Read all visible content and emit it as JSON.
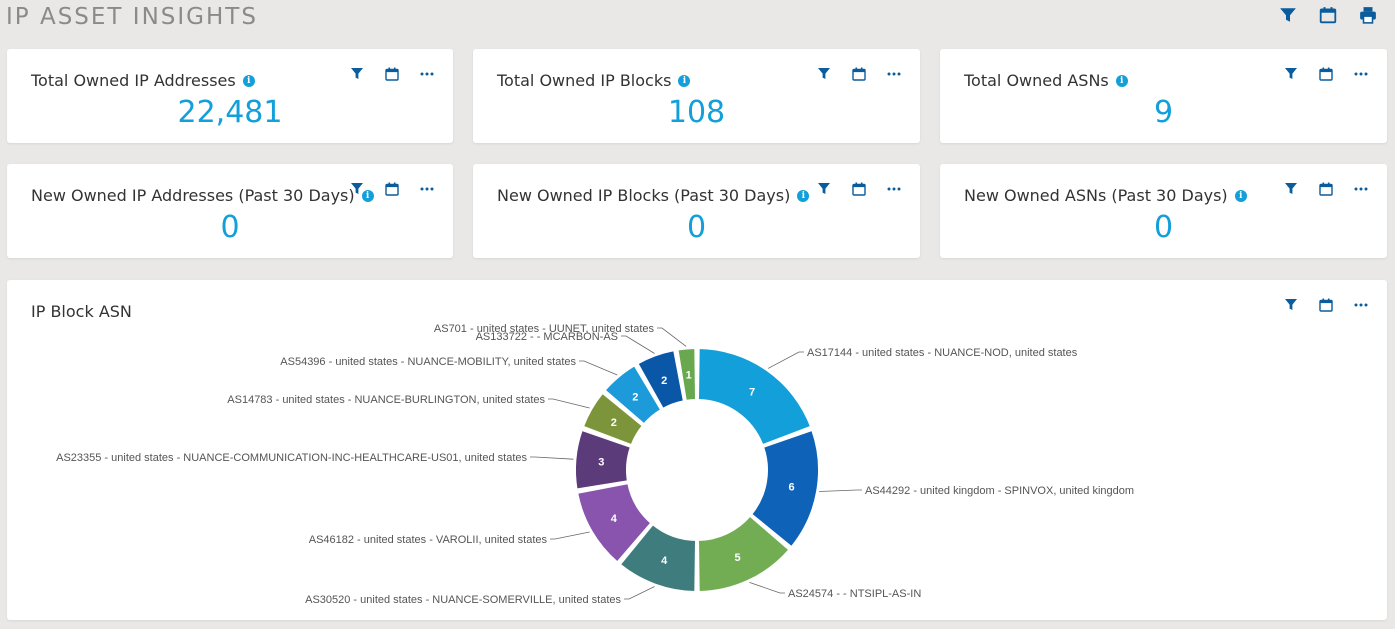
{
  "page": {
    "title": "IP ASSET INSIGHTS"
  },
  "colors": {
    "accent": "#139fd9",
    "icon": "#0a5c9c"
  },
  "cards": [
    {
      "title": "Total Owned IP Addresses",
      "value": "22,481"
    },
    {
      "title": "Total Owned IP Blocks",
      "value": "108"
    },
    {
      "title": "Total Owned ASNs",
      "value": "9"
    },
    {
      "title": "New Owned IP Addresses (Past 30 Days)",
      "value": "0"
    },
    {
      "title": "New Owned IP Blocks (Past 30 Days)",
      "value": "0"
    },
    {
      "title": "New Owned ASNs (Past 30 Days)",
      "value": "0"
    }
  ],
  "chart_panel": {
    "title": "IP Block ASN"
  },
  "icons": {
    "filter": "filter-icon",
    "calendar": "calendar-icon",
    "print": "print-icon",
    "more": "more-icon",
    "info": "info-icon"
  },
  "chart_data": {
    "type": "pie",
    "variant": "donut",
    "title": "IP Block ASN",
    "slices": [
      {
        "label": "AS17144 - united states - NUANCE-NOD, united states",
        "value": 7,
        "color": "#139fd9"
      },
      {
        "label": "AS44292 - united kingdom - SPINVOX, united kingdom",
        "value": 6,
        "color": "#0e63b8"
      },
      {
        "label": "AS24574 - - NTSIPL-AS-IN",
        "value": 5,
        "color": "#72ad53"
      },
      {
        "label": "AS30520 - united states - NUANCE-SOMERVILLE, united states",
        "value": 4,
        "color": "#3e7c7d"
      },
      {
        "label": "AS46182 - united states - VAROLII, united states",
        "value": 4,
        "color": "#8854ad"
      },
      {
        "label": "AS23355 - united states - NUANCE-COMMUNICATION-INC-HEALTHCARE-US01, united states",
        "value": 3,
        "color": "#5c3b7a"
      },
      {
        "label": "AS14783 - united states - NUANCE-BURLINGTON, united states",
        "value": 2,
        "color": "#7d953a"
      },
      {
        "label": "AS54396 - united states - NUANCE-MOBILITY, united states",
        "value": 2,
        "color": "#1d9ad9"
      },
      {
        "label": "AS133722 - - MCARBON-AS",
        "value": 2,
        "color": "#0a57a8"
      },
      {
        "label": "AS701 - united states - UUNET, united states",
        "value": 1,
        "color": "#6aa84f"
      }
    ]
  }
}
